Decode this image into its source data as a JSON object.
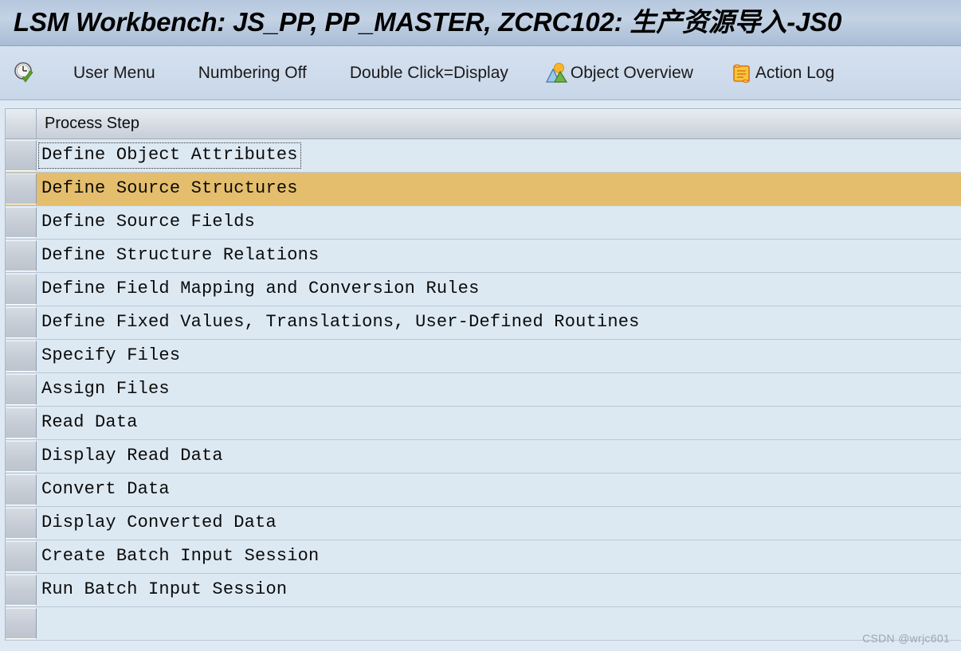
{
  "window": {
    "title": "LSM Workbench: JS_PP, PP_MASTER, ZCRC102: 生产资源导入-JS0"
  },
  "toolbar": {
    "items": [
      {
        "label": "",
        "icon": "clock-check-icon",
        "has_icon": true
      },
      {
        "label": "User Menu",
        "icon": "",
        "has_icon": false
      },
      {
        "label": "Numbering Off",
        "icon": "",
        "has_icon": false
      },
      {
        "label": "Double Click=Display",
        "icon": "",
        "has_icon": false
      },
      {
        "label": "Object Overview",
        "icon": "image-mountains-icon",
        "has_icon": true
      },
      {
        "label": "Action Log",
        "icon": "scroll-icon",
        "has_icon": true
      }
    ]
  },
  "grid": {
    "columns": [
      "Process Step"
    ],
    "selected_index": 1,
    "focused_index": 0,
    "rows": [
      {
        "label": "Define Object Attributes"
      },
      {
        "label": "Define Source Structures"
      },
      {
        "label": "Define Source Fields"
      },
      {
        "label": "Define Structure Relations"
      },
      {
        "label": "Define Field Mapping and Conversion Rules"
      },
      {
        "label": "Define Fixed Values, Translations, User-Defined Routines"
      },
      {
        "label": "Specify Files"
      },
      {
        "label": "Assign Files"
      },
      {
        "label": "Read Data"
      },
      {
        "label": "Display Read Data"
      },
      {
        "label": "Convert Data"
      },
      {
        "label": "Display Converted Data"
      },
      {
        "label": "Create Batch Input Session"
      },
      {
        "label": "Run Batch Input Session"
      },
      {
        "label": ""
      }
    ]
  },
  "watermark": {
    "text": "CSDN @wrjc601"
  },
  "colors": {
    "selected_row": "#e4be6c",
    "row_background": "#dde9f2",
    "panel_background": "#dfe9f3",
    "title_bar": "#b6c8de"
  }
}
